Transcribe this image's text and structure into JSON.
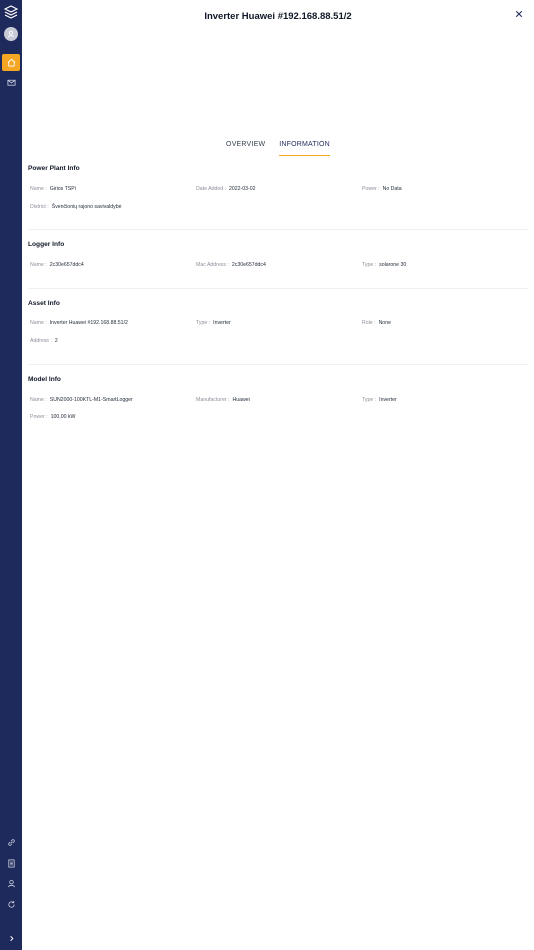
{
  "header": {
    "title": "Inverter Huawei #192.168.88.51/2"
  },
  "tabs": [
    {
      "label": "OVERVIEW",
      "active": false
    },
    {
      "label": "INFORMATION",
      "active": true
    }
  ],
  "sections": {
    "power_plant": {
      "title": "Power Plant Info",
      "name_label": "Name :",
      "name_value": "Girios TSPi",
      "date_label": "Date Added :",
      "date_value": "2022-03-02",
      "power_label": "Power :",
      "power_value": "No Data",
      "district_label": "District :",
      "district_value": "Švenčionių rajono savivaldybė"
    },
    "logger": {
      "title": "Logger Info",
      "name_label": "Name :",
      "name_value": "2c30e657ddc4",
      "mac_label": "Mac Address :",
      "mac_value": "2c30e657ddc4",
      "type_label": "Type :",
      "type_value": "solarone 30"
    },
    "asset": {
      "title": "Asset Info",
      "name_label": "Name :",
      "name_value": "Inverter Huawei #192.168.88.51/2",
      "type_label": "Type :",
      "type_value": "Inverter",
      "role_label": "Role :",
      "role_value": "None",
      "address_label": "Address :",
      "address_value": "2"
    },
    "model": {
      "title": "Model Info",
      "name_label": "Name :",
      "name_value": "SUN2000-100KTL-M1-SmartLogger",
      "manufacturer_label": "Manufacturer :",
      "manufacturer_value": "Huawei",
      "type_label": "Type :",
      "type_value": "Inverter",
      "power_label": "Power :",
      "power_value": "100.00 kW"
    }
  },
  "sidebar": {
    "icons": [
      "logo-icon",
      "avatar-icon",
      "home-icon",
      "mail-icon",
      "link-icon",
      "document-icon",
      "user-icon",
      "refresh-icon",
      "chevron-right-icon"
    ]
  },
  "colors": {
    "sidebar": "#1f2a5c",
    "accent": "#f5a623"
  }
}
